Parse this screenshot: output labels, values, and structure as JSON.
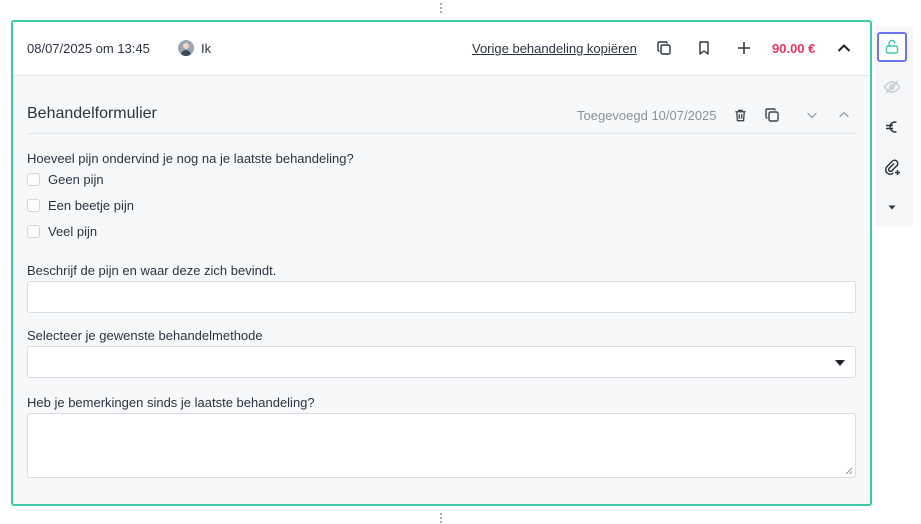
{
  "header": {
    "date": "08/07/2025 om 13:45",
    "user": "Ik",
    "copy_previous_link": "Vorige behandeling kopiëren",
    "price": "90.00 €"
  },
  "form": {
    "title": "Behandelformulier",
    "added": "Toegevoegd 10/07/2025",
    "q1": {
      "label": "Hoeveel pijn ondervind je nog na je laatste behandeling?",
      "options": [
        "Geen pijn",
        "Een beetje pijn",
        "Veel pijn"
      ]
    },
    "q2": {
      "label": "Beschrijf de pijn en waar deze zich bevindt.",
      "value": ""
    },
    "q3": {
      "label": "Selecteer je gewenste behandelmethode",
      "selected": ""
    },
    "q4": {
      "label": "Heb je bemerkingen sinds je laatste behandeling?",
      "value": ""
    }
  },
  "colors": {
    "card_border": "#3cc9a6",
    "price": "#e8365b",
    "lock_active": "#3cc9a6",
    "active_outline": "#6d73f0"
  },
  "icons": {
    "header": [
      "copy-icon",
      "bookmark-icon",
      "plus-icon",
      "chevron-up-icon"
    ],
    "section": [
      "trash-icon",
      "copy-icon",
      "chevron-down-icon",
      "chevron-up-icon"
    ],
    "rail": [
      "unlock-icon",
      "eye-off-icon",
      "euro-icon",
      "attach-add-icon",
      "caret-down-icon"
    ]
  }
}
